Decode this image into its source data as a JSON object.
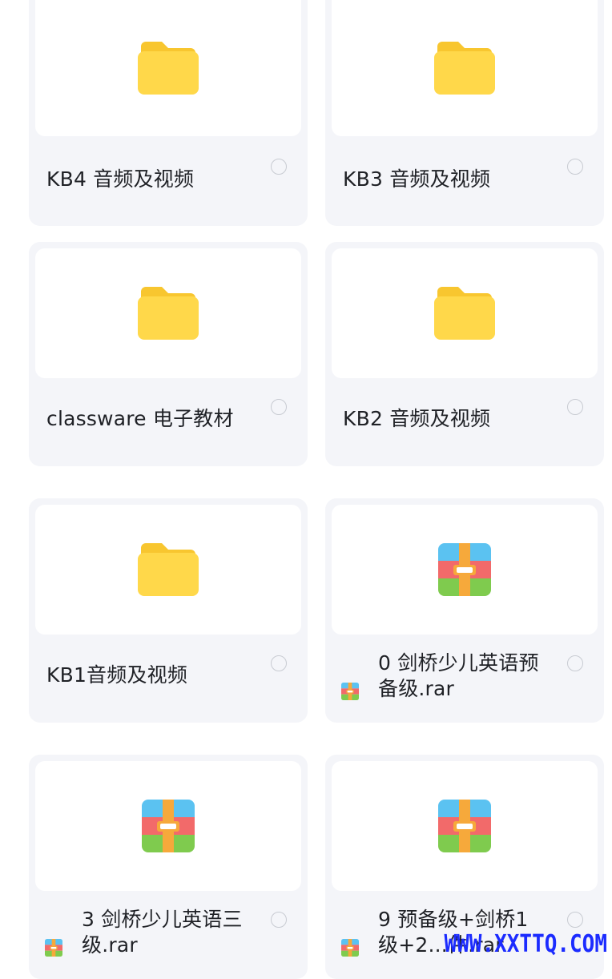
{
  "files": [
    {
      "name": "KB4 音频及视频",
      "type": "folder"
    },
    {
      "name": "KB3 音频及视频",
      "type": "folder"
    },
    {
      "name": "classware 电子教材",
      "type": "folder"
    },
    {
      "name": "KB2 音频及视频",
      "type": "folder"
    },
    {
      "name": "KB1音频及视频",
      "type": "folder"
    },
    {
      "name": "0 剑桥少儿英语预备级.rar",
      "type": "archive"
    },
    {
      "name": "3 剑桥少儿英语三级.rar",
      "type": "archive"
    },
    {
      "name": "9 预备级+剑桥1级+2...件.rar",
      "type": "archive"
    }
  ],
  "icons": {
    "folder": "folder-icon",
    "archive": "archive-icon",
    "select": "radio-circle"
  },
  "colors": {
    "folder": "#FFD84A",
    "folder_tab": "#F8C62F",
    "archive_top": "#5BC2F1",
    "archive_mid": "#F26A6A",
    "archive_bottom": "#7FCB4E",
    "archive_strap": "#F6A93B",
    "watermark": "#1B2BFF"
  },
  "watermark": "WWW.XXTTQ.COM"
}
